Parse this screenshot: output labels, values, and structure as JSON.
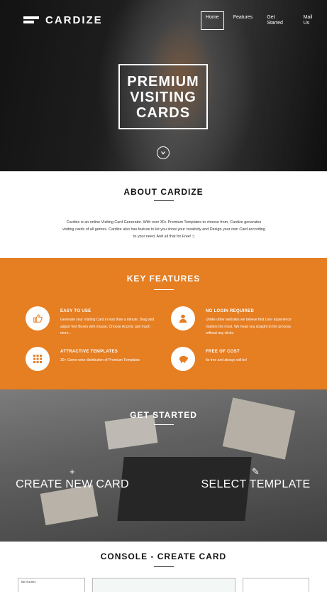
{
  "brand": {
    "name": "CARDIZE"
  },
  "nav": {
    "items": [
      {
        "label": "Home",
        "active": true
      },
      {
        "label": "Features",
        "active": false
      },
      {
        "label": "Get Started",
        "active": false
      },
      {
        "label": "Mail Us",
        "active": false
      }
    ]
  },
  "hero": {
    "line1": "PREMIUM",
    "line2": "VISITING",
    "line3": "CARDS",
    "scroll_icon": "chevron-down-icon"
  },
  "about": {
    "title": "ABOUT CARDIZE",
    "text": "Cardize is an online Visiting Card Generator. With over 30+ Premium Templates to choose from, Cardize generates visiting cards of all genres. Cardize also has feature to let you show your creativity and Design your own Card according to your need. And all that for Free! :)"
  },
  "features": {
    "title": "KEY FEATURES",
    "accent": "#e67e22",
    "items": [
      {
        "icon": "thumbs-up-icon",
        "title": "EASY TO USE",
        "text": "Generate your Visiting Card in less than a minute. Drag and adjust Text Boxes with mouse, Choose Accent, and much more..."
      },
      {
        "icon": "user-icon",
        "title": "NO LOGIN REQUIRED",
        "text": "Unlike other websites we believe that User Experience matters the most. We head you straight to the process without any clicks."
      },
      {
        "icon": "grid-icon",
        "title": "ATTRACTIVE TEMPLATES",
        "text": "30+ Genre-wise distribution of Premium Templates"
      },
      {
        "icon": "piggy-bank-icon",
        "title": "FREE OF COST",
        "text": "Its free and always will be!"
      }
    ]
  },
  "started": {
    "title": "GET STARTED",
    "create_symbol": "+",
    "create_label": "CREATE NEW CARD",
    "select_symbol": "✎",
    "select_label": "SELECT TEMPLATE"
  },
  "console": {
    "title": "CONSOLE - CREATE CARD",
    "panel_label": "Bill Hourfex"
  }
}
